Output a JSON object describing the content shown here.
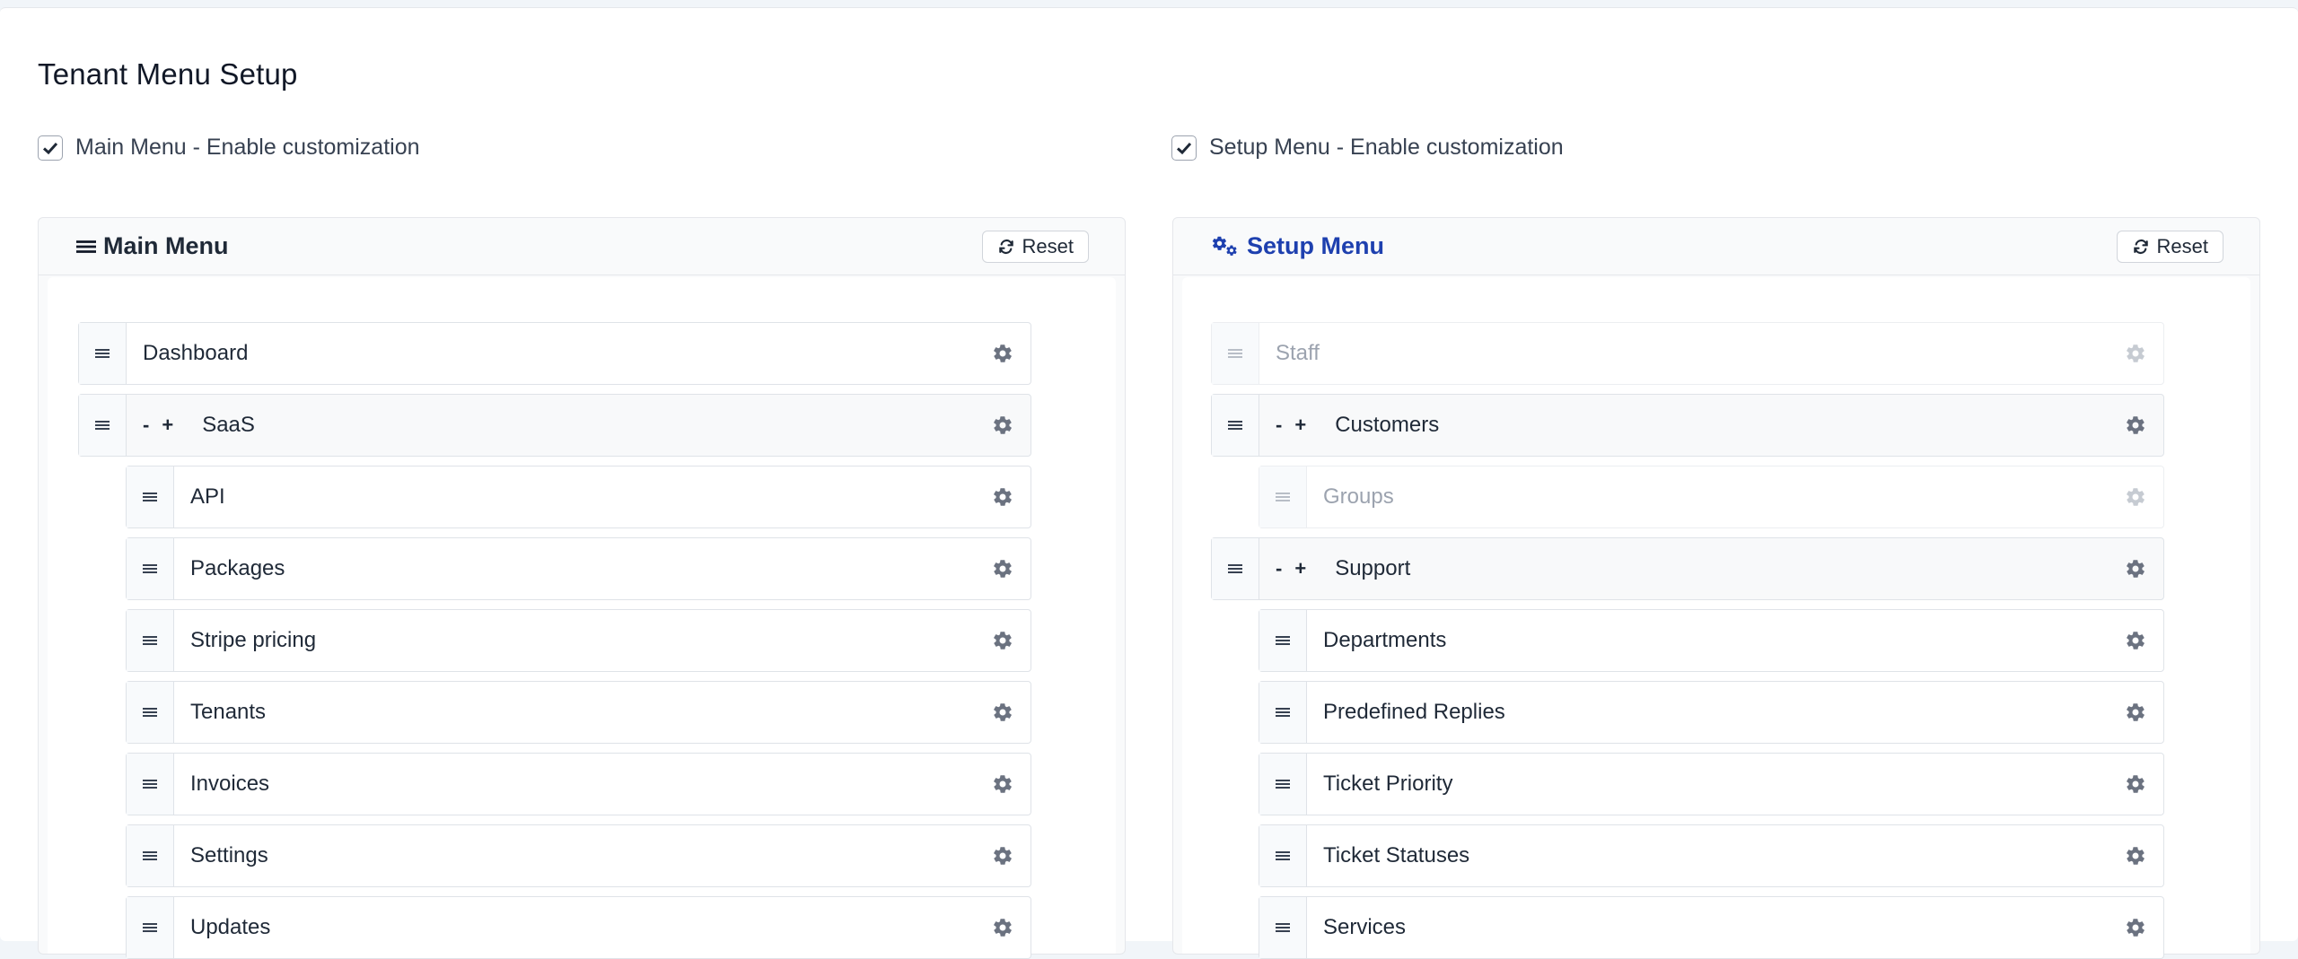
{
  "page": {
    "title": "Tenant Menu Setup"
  },
  "options": {
    "main_label": "Main Menu - Enable customization",
    "setup_label": "Setup Menu - Enable customization"
  },
  "main_panel": {
    "title": "Main Menu",
    "reset_label": "Reset",
    "icon": "bars-icon",
    "items": [
      {
        "label": "Dashboard"
      },
      {
        "label": "SaaS",
        "toggle_minus": "-",
        "toggle_plus": "+"
      },
      {
        "label": "API"
      },
      {
        "label": "Packages"
      },
      {
        "label": "Stripe pricing"
      },
      {
        "label": "Tenants"
      },
      {
        "label": "Invoices"
      },
      {
        "label": "Settings"
      },
      {
        "label": "Updates"
      }
    ]
  },
  "setup_panel": {
    "title": "Setup Menu",
    "reset_label": "Reset",
    "icon": "cogs-icon",
    "title_color": "#1e40af",
    "items": [
      {
        "label": "Staff"
      },
      {
        "label": "Customers",
        "toggle_minus": "-",
        "toggle_plus": "+"
      },
      {
        "label": "Groups"
      },
      {
        "label": "Support",
        "toggle_minus": "-",
        "toggle_plus": "+"
      },
      {
        "label": "Departments"
      },
      {
        "label": "Predefined Replies"
      },
      {
        "label": "Ticket Priority"
      },
      {
        "label": "Ticket Statuses"
      },
      {
        "label": "Services"
      }
    ]
  }
}
